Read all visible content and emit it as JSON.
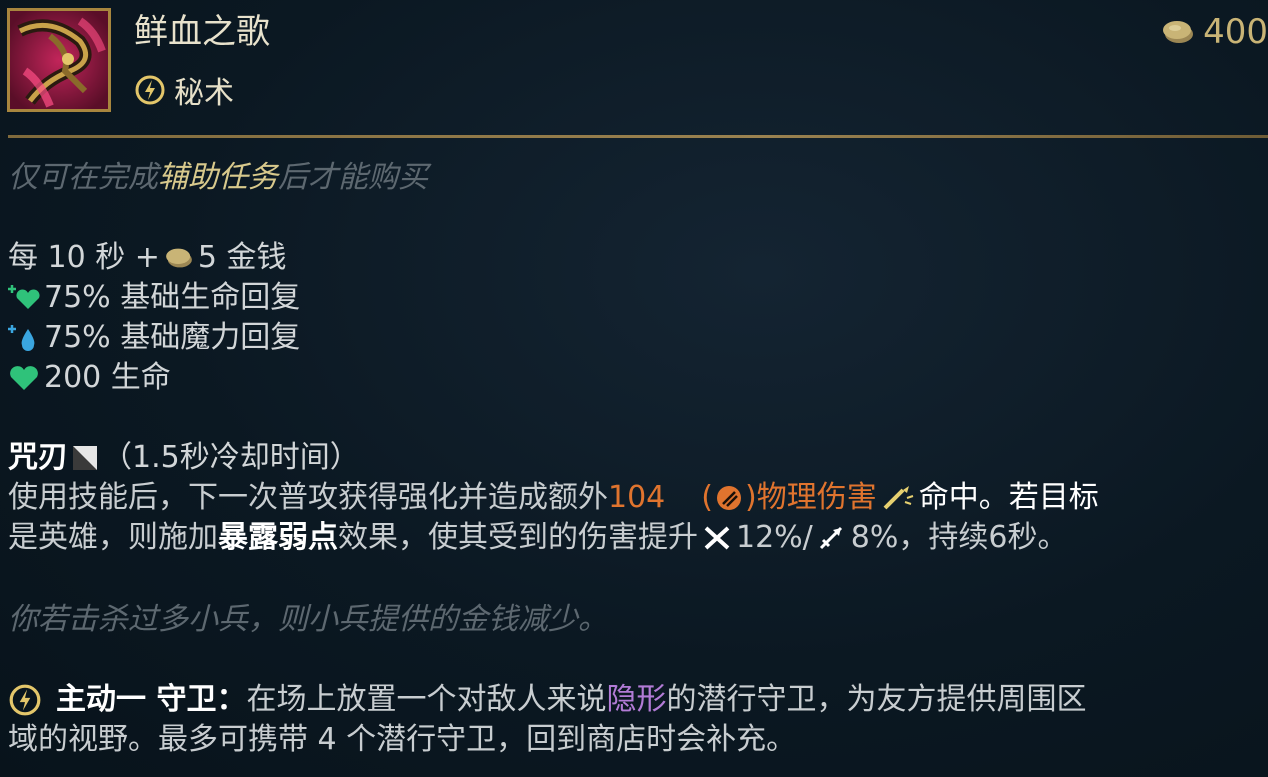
{
  "item": {
    "name": "鲜血之歌",
    "tag": "秘术",
    "price": "400"
  },
  "requirement": {
    "prefix": "仅可在完成",
    "highlight": "辅助任务",
    "suffix": "后才能购买"
  },
  "stats": {
    "gold_prefix": "每 10 秒 +",
    "gold_suffix": "5 金钱",
    "health_regen": "75% 基础生命回复",
    "mana_regen": "75% 基础魔力回复",
    "health": "200 生命"
  },
  "passive": {
    "name": "咒刃",
    "cooldown": "（1.5秒冷却时间）",
    "line1_a": "使用技能后，下一次普攻获得强化并造成额外",
    "line1_value": "104",
    "line1_ratio_open": "(",
    "line1_ratio_close": ")物理伤害",
    "line1_b": "命中。若目标",
    "line2_a": "是英雄，则施加",
    "line2_keyword": "暴露弱点",
    "line2_b": "效果，使其受到的伤害提升",
    "line2_melee": "12%/",
    "line2_ranged": "8%，持续6秒。"
  },
  "note": "你若击杀过多小兵，则小兵提供的金钱减少。",
  "active": {
    "label": "主动一 守卫：",
    "line1_a": "在场上放置一个对敌人来说",
    "line1_keyword": "隐形",
    "line1_b": "的潜行守卫，为友方提供周围区",
    "line2": "域的视野。最多可携带 4 个潜行守卫，回到商店时会补充。"
  },
  "colors": {
    "gold": "#d8c98c",
    "orange": "#e0742e",
    "health_green": "#2fc27a",
    "mana_blue": "#3aa6e0",
    "violet": "#b27bd6"
  },
  "icons": [
    "gold-coin-icon",
    "arcane-icon",
    "health-regen-icon",
    "mana-regen-icon",
    "heart-icon",
    "spellblade-icon",
    "physical-damage-icon",
    "on-hit-icon",
    "melee-icon",
    "ranged-icon",
    "active-icon"
  ]
}
